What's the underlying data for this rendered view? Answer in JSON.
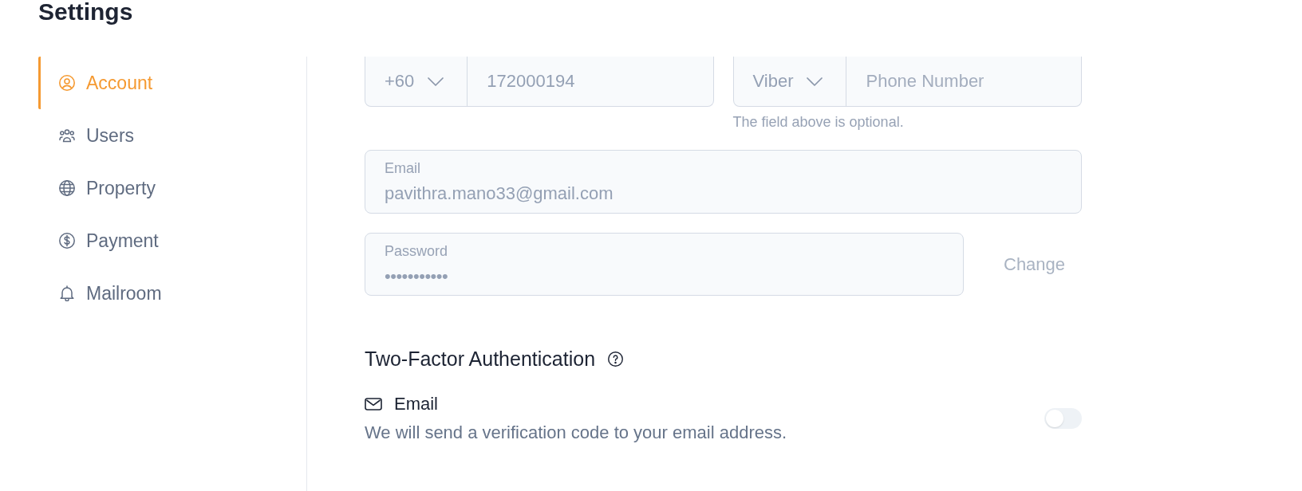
{
  "page": {
    "title": "Settings"
  },
  "sidebar": {
    "items": [
      {
        "label": "Account",
        "selected": true
      },
      {
        "label": "Users",
        "selected": false
      },
      {
        "label": "Property",
        "selected": false
      },
      {
        "label": "Payment",
        "selected": false
      },
      {
        "label": "Mailroom",
        "selected": false
      }
    ]
  },
  "phone": {
    "country_code": "+60",
    "value": "172000194"
  },
  "messenger": {
    "app": "Viber",
    "placeholder": "Phone Number",
    "hint": "The field above is optional."
  },
  "email": {
    "label": "Email",
    "value": "pavithra.mano33@gmail.com"
  },
  "password": {
    "label": "Password",
    "value": "•••••••••••",
    "change_button": {
      "label": "Change",
      "disabled": true
    }
  },
  "two_factor": {
    "title": "Two-Factor Authentication",
    "methods": [
      {
        "label": "Email",
        "description": "We will send a verification code to your email address.",
        "on": false
      }
    ]
  }
}
